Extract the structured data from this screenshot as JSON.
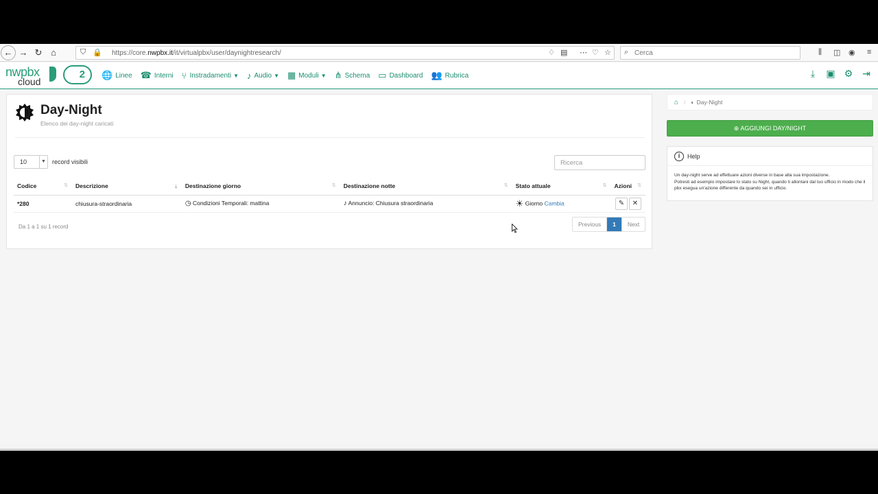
{
  "browser": {
    "url_prefix": "https://core.",
    "url_domain": "nwpbx.it",
    "url_path": "/it/virtualpbx/user/daynightresearch/",
    "search_placeholder": "Cerca"
  },
  "app": {
    "logo_top": "nwpbx",
    "logo_bottom": "cloud",
    "cloud_version": "2"
  },
  "menu": [
    {
      "label": "Linee",
      "icon": "globe-icon",
      "glyph": "🌐",
      "caret": false
    },
    {
      "label": "Interni",
      "icon": "phone-icon",
      "glyph": "☎",
      "caret": false
    },
    {
      "label": "Instradamenti",
      "icon": "route-icon",
      "glyph": "⑂",
      "caret": true
    },
    {
      "label": "Audio",
      "icon": "music-icon",
      "glyph": "♪",
      "caret": true
    },
    {
      "label": "Moduli",
      "icon": "grid-icon",
      "glyph": "▦",
      "caret": true
    },
    {
      "label": "Schema",
      "icon": "sitemap-icon",
      "glyph": "⋔",
      "caret": false
    },
    {
      "label": "Dashboard",
      "icon": "monitor-icon",
      "glyph": "▭",
      "caret": false
    },
    {
      "label": "Rubrica",
      "icon": "users-icon",
      "glyph": "👥",
      "caret": false
    }
  ],
  "page": {
    "title": "Day-Night",
    "subtitle": "Elenco dei day-night caricati"
  },
  "table": {
    "length_value": "10",
    "length_label": "record visibili",
    "search_placeholder": "Ricerca",
    "headers": [
      "Codice",
      "Descrizione",
      "Destinazione giorno",
      "Destinazione notte",
      "Stato attuale",
      "Azioni"
    ],
    "rows": [
      {
        "code": "*280",
        "description": "chiusura-straordinaria",
        "day_destination": "Condizioni Temporali: mattina",
        "night_destination": "Annuncio: Chiusura straordinaria",
        "state": "Giorno",
        "change_link": "Cambia"
      }
    ],
    "info": "Da 1 a 1 su 1 record",
    "pager": {
      "previous": "Previous",
      "current": "1",
      "next": "Next"
    }
  },
  "sidebar": {
    "breadcrumb": "Day-Night",
    "add_button": "AGGIUNGI DAY/NIGHT",
    "help_title": "Help",
    "help_text_1": "Un day-night serve ad effettuare azioni diverse in base alla sua impostazione.",
    "help_text_2": "Potresti ad esempio impostare lo stato su Night, quando ti allontani dal tuo ufficio in modo che il pbx esegua un'azione differente da quando sei in ufficio."
  },
  "colors": {
    "brand": "#1a8f6f",
    "add_button": "#4cae4c",
    "pager_active": "#337ab7"
  }
}
